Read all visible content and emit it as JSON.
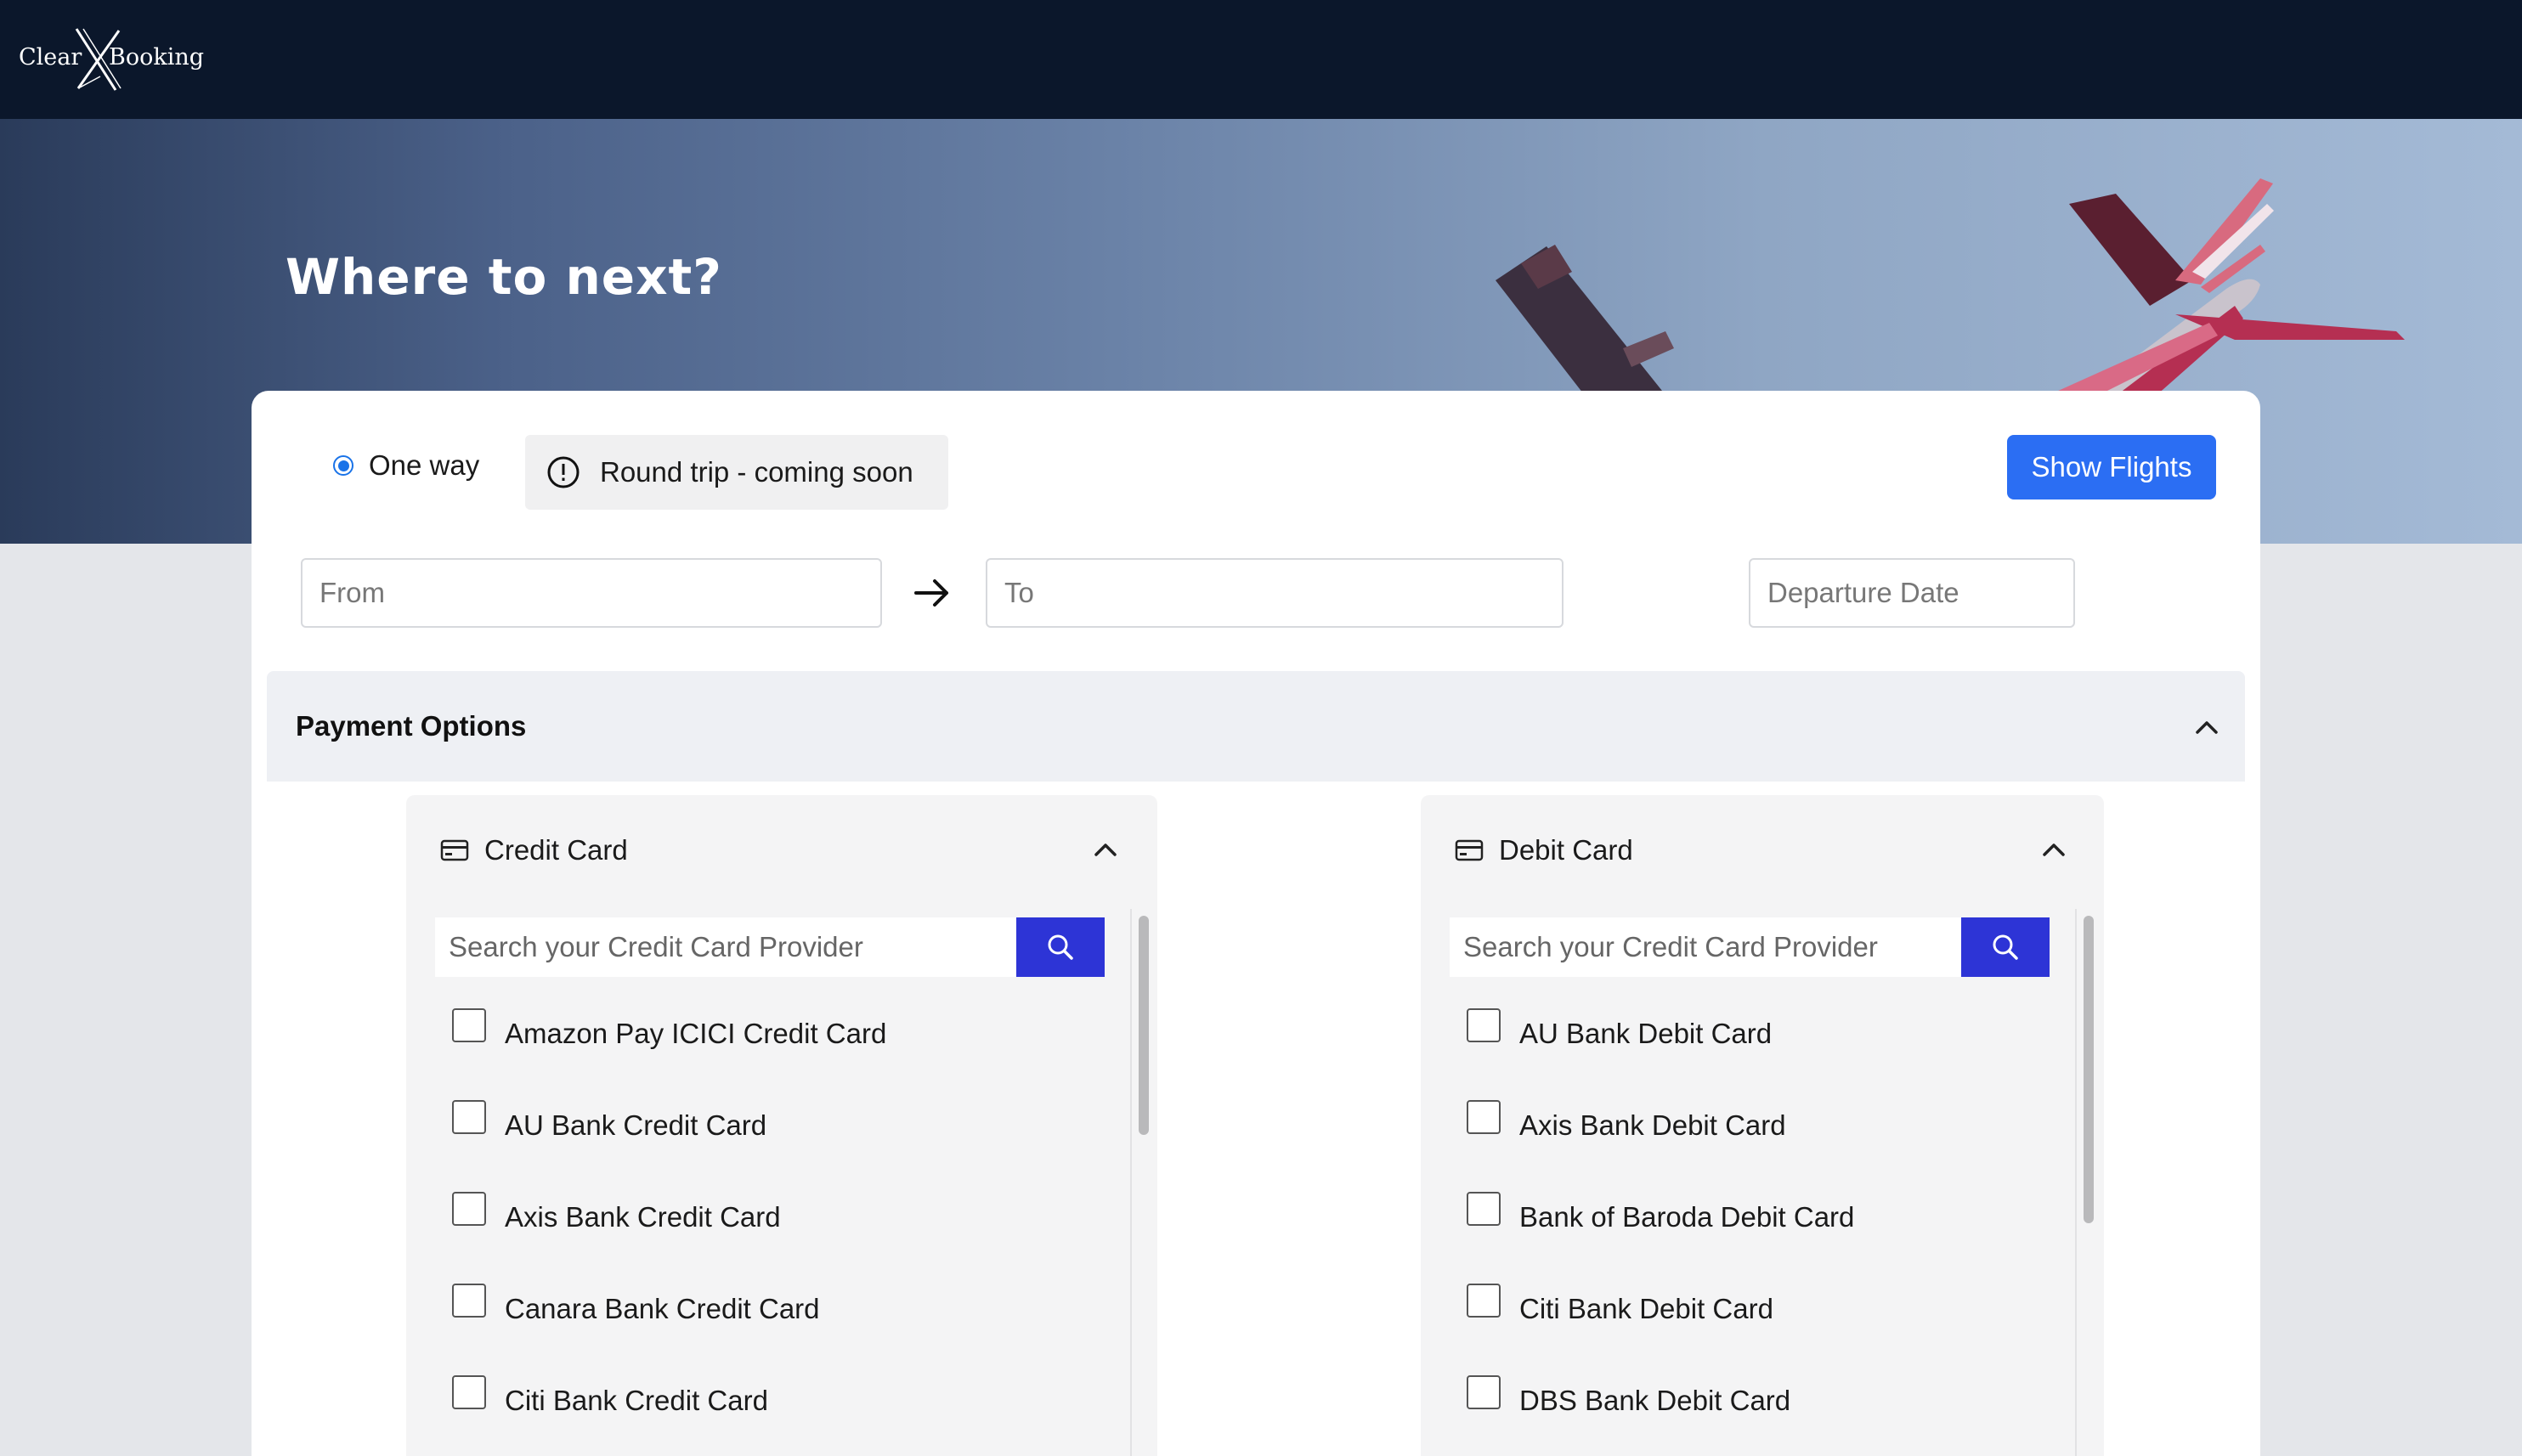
{
  "brand": {
    "left": "Clear",
    "right": "Booking"
  },
  "hero": {
    "title": "Where to next?"
  },
  "trip_type": {
    "one_way": "One way",
    "round_trip": "Round trip - coming soon"
  },
  "actions": {
    "show_flights": "Show Flights"
  },
  "search": {
    "from_placeholder": "From",
    "to_placeholder": "To",
    "date_placeholder": "Departure Date"
  },
  "payment": {
    "title": "Payment Options",
    "credit": {
      "title": "Credit Card",
      "search_placeholder": "Search your Credit Card Provider",
      "items": [
        "Amazon Pay ICICI Credit Card",
        "AU Bank Credit Card",
        "Axis Bank Credit Card",
        "Canara Bank Credit Card",
        "Citi Bank Credit Card"
      ]
    },
    "debit": {
      "title": "Debit Card",
      "search_placeholder": "Search your Credit Card Provider",
      "items": [
        "AU Bank Debit Card",
        "Axis Bank Debit Card",
        "Bank of Baroda Debit Card",
        "Citi Bank Debit Card",
        "DBS Bank Debit Card"
      ]
    }
  },
  "colors": {
    "topbar": "#0b172b",
    "primary_button": "#2b6ef3",
    "search_button": "#2d34d6",
    "radio_accent": "#1a73e8"
  }
}
